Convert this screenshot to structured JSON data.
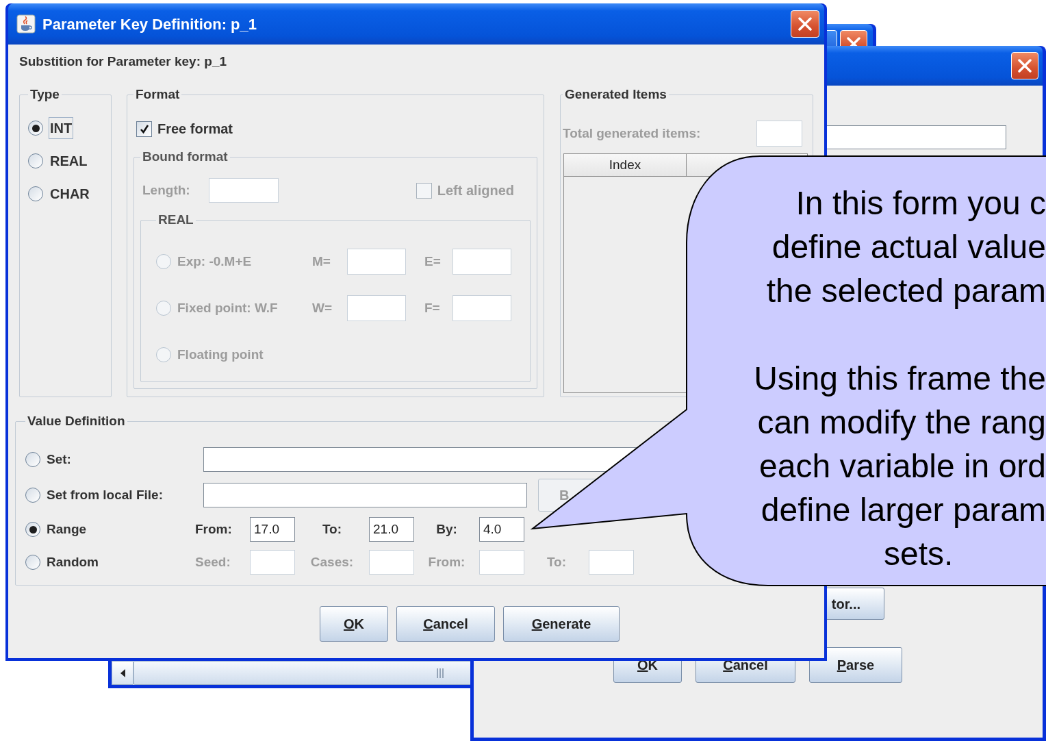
{
  "right_window": {
    "side_button": "tor...",
    "buttons": [
      "OK",
      "Cancel",
      "Parse"
    ]
  },
  "dialog": {
    "title": "Parameter Key Definition: p_1",
    "subtitle": "Substition for Parameter key: p_1",
    "type_group": {
      "title": "Type",
      "options": [
        {
          "label": "INT",
          "selected": true
        },
        {
          "label": "REAL",
          "selected": false
        },
        {
          "label": "CHAR",
          "selected": false
        }
      ]
    },
    "format_group": {
      "title": "Format",
      "free_format": {
        "label": "Free format",
        "checked": true
      },
      "bound_format": {
        "title": "Bound format",
        "disabled": true,
        "length_label": "Length:",
        "left_aligned": {
          "label": "Left aligned",
          "checked": false
        },
        "real_group": {
          "title": "REAL",
          "options": [
            {
              "label": "Exp: -0.M+E",
              "selected": false,
              "field_1_label": "M=",
              "field_2_label": "E="
            },
            {
              "label": "Fixed point: W.F",
              "selected": false,
              "field_1_label": "W=",
              "field_2_label": "F="
            },
            {
              "label": "Floating point",
              "selected": false
            }
          ]
        }
      }
    },
    "generated_items": {
      "title": "Generated Items",
      "total_label": "Total generated items:",
      "disabled": true,
      "columns": [
        "Index"
      ]
    },
    "value_definition": {
      "title": "Value Definition",
      "rows": [
        {
          "kind": "set",
          "label": "Set:",
          "selected": false
        },
        {
          "kind": "file",
          "label": "Set from local File:",
          "selected": false,
          "button": "B"
        },
        {
          "kind": "range",
          "label": "Range",
          "selected": true,
          "disabled": false,
          "fields": [
            {
              "label": "From:",
              "value": "17.0"
            },
            {
              "label": "To:",
              "value": "21.0"
            },
            {
              "label": "By:",
              "value": "4.0"
            }
          ]
        },
        {
          "kind": "range",
          "label": "Random",
          "selected": false,
          "disabled": true,
          "fields": [
            {
              "label": "Seed:"
            },
            {
              "label": "Cases:"
            },
            {
              "label": "From:"
            },
            {
              "label": "To:"
            }
          ]
        }
      ]
    },
    "buttons": [
      "OK",
      "Cancel",
      "Generate"
    ]
  },
  "callout": {
    "paragraphs": [
      [
        "In this form you c",
        "define actual value",
        "the selected param"
      ],
      [
        "Using this frame the",
        "can modify the rang",
        "each variable in ord",
        "define larger param",
        "sets."
      ]
    ]
  }
}
